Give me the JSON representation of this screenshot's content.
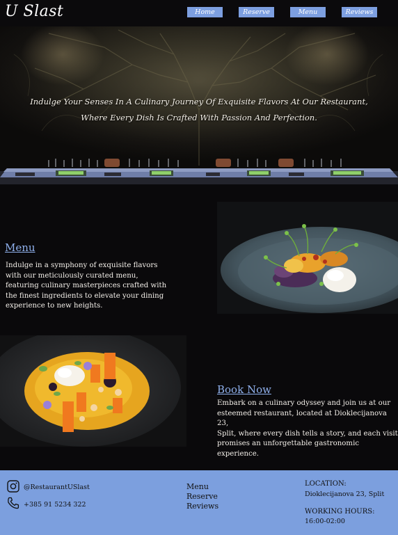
{
  "header": {
    "logo": "U Slast",
    "nav": [
      "Home",
      "Reserve",
      "Menu",
      "Reviews"
    ]
  },
  "hero": {
    "line1": "Indulge Your Senses In A Culinary Journey Of Exquisite Flavors At Our Restaurant,",
    "line2": "Where Every Dish Is Crafted With Passion And Perfection."
  },
  "menu_section": {
    "title": "Menu",
    "lines": [
      "Indulge in a symphony of exquisite flavors",
      "with our meticulously curated menu,",
      "featuring culinary masterpieces crafted with",
      "the finest ingredients to elevate your dining",
      "experience to new heights."
    ]
  },
  "book_section": {
    "title": "Book Now",
    "lines": [
      "Embark on a culinary odyssey and join us at our",
      "esteemed restaurant, located at Dioklecijanova 23,",
      "Split, where every dish tells a story, and each visit",
      "promises an unforgettable gastronomic experience."
    ]
  },
  "footer": {
    "instagram": "@RestaurantUSlast",
    "phone": "+385 91 5234 322",
    "links": [
      "Menu",
      "Reserve",
      "Reviews"
    ],
    "location_label": "LOCATION:",
    "location_value": "Dioklecijanova 23, Split",
    "hours_label": "WORKING HOURS:",
    "hours_value": "16:00-02:00"
  },
  "colors": {
    "accent": "#7d9fe0",
    "background": "#0a090b",
    "footer": "#7c9fde",
    "link": "#8fb0ec"
  }
}
